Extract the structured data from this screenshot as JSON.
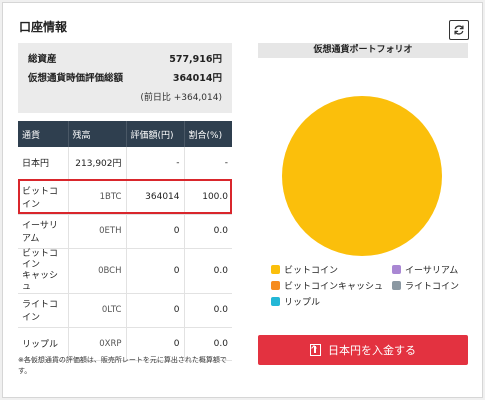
{
  "account": {
    "title": "口座情報",
    "refresh_icon": "refresh-icon"
  },
  "summary": {
    "total_label": "総資産",
    "total_value": "577,916円",
    "crypto_label": "仮想通貨時価評価総額",
    "crypto_value": "364014円",
    "change_note": "(前日比 +364,014)"
  },
  "table": {
    "headers": [
      "通貨",
      "残高",
      "評価額(円)",
      "割合(%)"
    ],
    "rows": [
      {
        "currency": "日本円",
        "balance": "213,902円",
        "value": "-",
        "ratio": "-"
      },
      {
        "currency": "ビットコイン",
        "balance": "1BTC",
        "value": "364014",
        "ratio": "100.0"
      },
      {
        "currency": "イーサリアム",
        "balance": "0ETH",
        "value": "0",
        "ratio": "0.0"
      },
      {
        "currency": "ビットコイン\nキャッシュ",
        "balance": "0BCH",
        "value": "0",
        "ratio": "0.0"
      },
      {
        "currency": "ライトコイン",
        "balance": "0LTC",
        "value": "0",
        "ratio": "0.0"
      },
      {
        "currency": "リップル",
        "balance": "0XRP",
        "value": "0",
        "ratio": "0.0"
      }
    ],
    "highlighted_row": "ビットコイン",
    "highlight_color": "#d9262c"
  },
  "footnote": "※各仮想通貨の評価額は、販売所レートを元に算出された概算額です。",
  "portfolio": {
    "title": "仮想通貨ポートフォリオ",
    "legend": [
      {
        "name": "ビットコイン",
        "color": "#fbbf0b"
      },
      {
        "name": "イーサリアム",
        "color": "#a987d3"
      },
      {
        "name": "ビットコインキャッシュ",
        "color": "#f68b1e"
      },
      {
        "name": "ライトコイン",
        "color": "#8b98a2"
      },
      {
        "name": "リップル",
        "color": "#23b7d6"
      }
    ]
  },
  "chart_data": {
    "type": "pie",
    "categories": [
      "ビットコイン",
      "イーサリアム",
      "ビットコインキャッシュ",
      "ライトコイン",
      "リップル"
    ],
    "values": [
      100.0,
      0.0,
      0.0,
      0.0,
      0.0
    ],
    "colors": [
      "#fbbf0b",
      "#a987d3",
      "#f68b1e",
      "#8b98a2",
      "#23b7d6"
    ],
    "title": "仮想通貨ポートフォリオ",
    "legend_position": "bottom"
  },
  "deposit_button": {
    "label": "日本円を入金する",
    "icon": "upload-icon",
    "color": "#e33240"
  }
}
